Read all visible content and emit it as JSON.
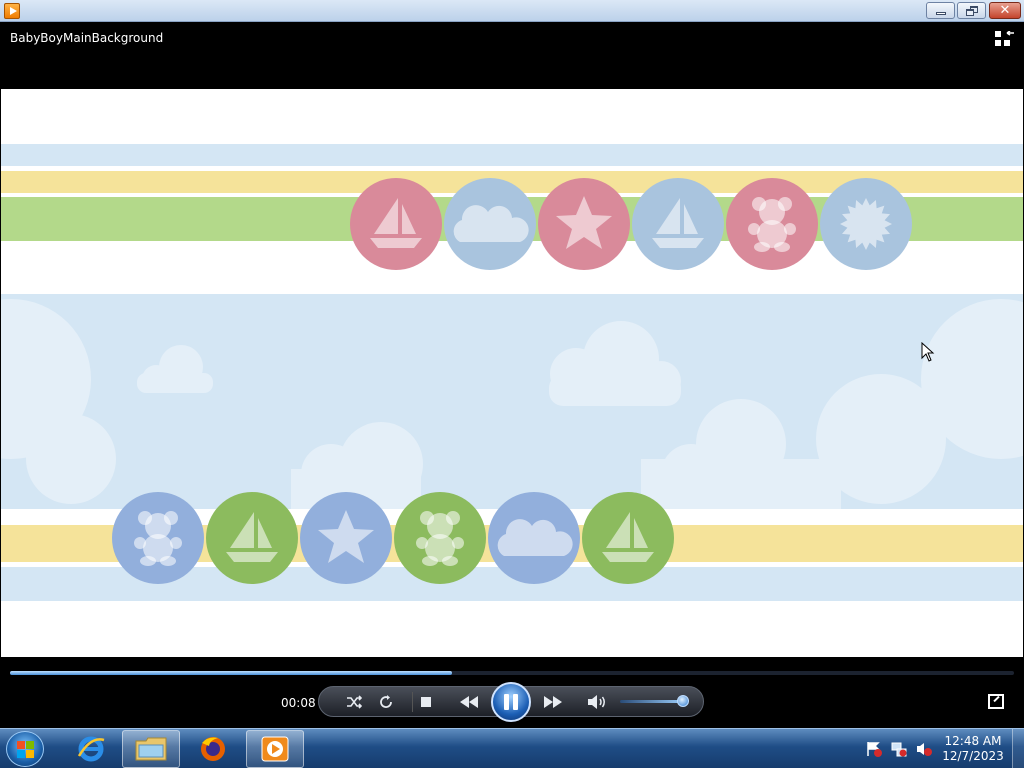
{
  "window": {
    "title_bar_controls": [
      "minimize",
      "restore",
      "close"
    ],
    "close_glyph": "✕"
  },
  "player": {
    "title": "BabyBoyMainBackground",
    "video": {
      "top_circles": [
        {
          "color": "#d98a9a",
          "icon": "sailboat-icon"
        },
        {
          "color": "#a9c4de",
          "icon": "cloud-icon"
        },
        {
          "color": "#d98a9a",
          "icon": "star-icon"
        },
        {
          "color": "#a9c4de",
          "icon": "sailboat-icon"
        },
        {
          "color": "#d98a9a",
          "icon": "teddy-bear-icon"
        },
        {
          "color": "#a9c4de",
          "icon": "sun-icon"
        }
      ],
      "bottom_circles": [
        {
          "color": "#92afdc",
          "icon": "teddy-bear-icon"
        },
        {
          "color": "#8cbb5e",
          "icon": "sailboat-icon"
        },
        {
          "color": "#92afdc",
          "icon": "star-icon"
        },
        {
          "color": "#8cbb5e",
          "icon": "teddy-bear-icon"
        },
        {
          "color": "#92afdc",
          "icon": "cloud-icon"
        },
        {
          "color": "#8cbb5e",
          "icon": "sailboat-icon"
        }
      ]
    },
    "controls": {
      "elapsed_time": "00:08",
      "seek_progress": 0.44,
      "volume_level": 0.95,
      "buttons": [
        "shuffle-icon",
        "repeat-icon",
        "stop-icon",
        "previous-icon",
        "pause-icon",
        "next-icon",
        "volume-icon"
      ]
    }
  },
  "taskbar": {
    "apps": [
      "internet-explorer-icon",
      "file-explorer-icon",
      "firefox-icon",
      "media-player-icon"
    ],
    "clock_time": "12:48 AM",
    "clock_date": "12/7/2023"
  },
  "colors": {
    "accent": "#1c5fb5",
    "stripe_yellow": "#f5e39a",
    "stripe_green": "#b3d98a",
    "sky_blue": "#d4e6f4"
  }
}
